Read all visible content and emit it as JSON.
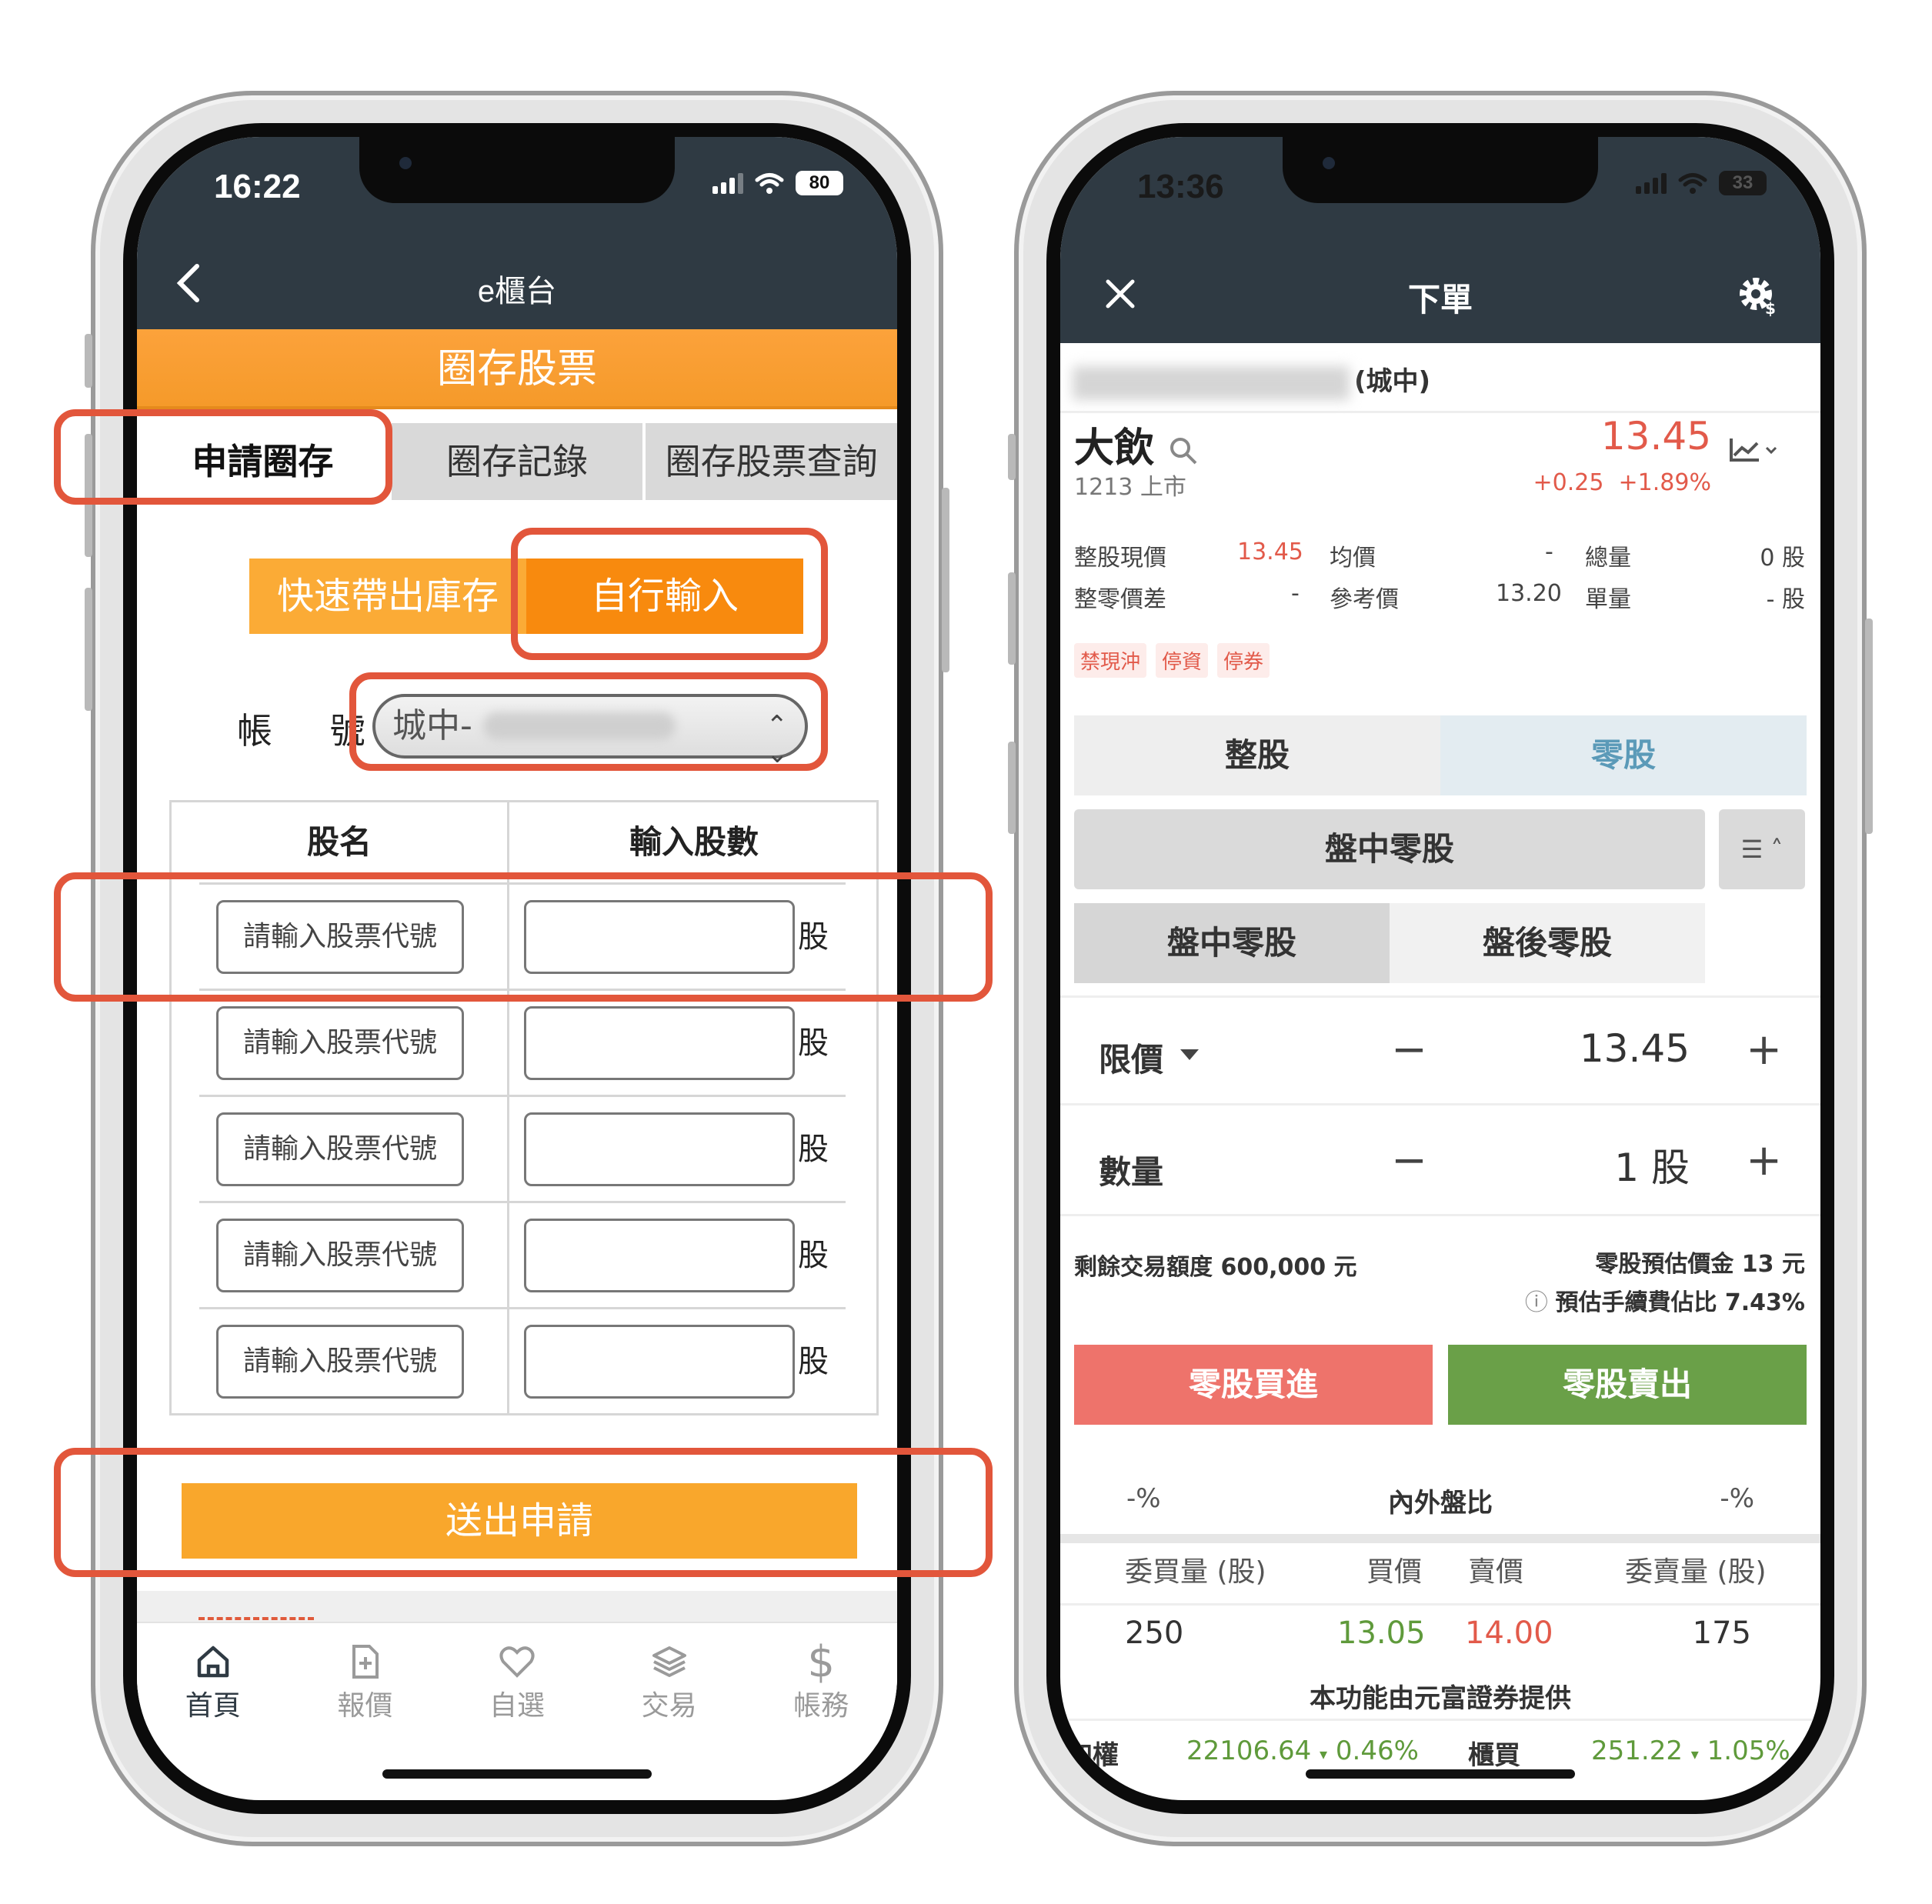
{
  "left_phone": {
    "status": {
      "time": "16:22",
      "battery": "80"
    },
    "header": {
      "title": "e櫃台"
    },
    "banner": {
      "title": "圈存股票"
    },
    "tabs": [
      {
        "label": "申請圈存",
        "active": true
      },
      {
        "label": "圈存記錄",
        "active": false
      },
      {
        "label": "圈存股票查詢",
        "active": false
      }
    ],
    "input_mode": {
      "quick": "快速帶出庫存",
      "manual": "自行輸入",
      "selected": "自行輸入"
    },
    "account": {
      "label": "帳 號",
      "value": "城中-"
    },
    "table": {
      "headers": [
        "股名",
        "輸入股數"
      ],
      "rows": [
        {
          "code_placeholder": "請輸入股票代號",
          "unit": "股"
        },
        {
          "code_placeholder": "請輸入股票代號",
          "unit": "股"
        },
        {
          "code_placeholder": "請輸入股票代號",
          "unit": "股"
        },
        {
          "code_placeholder": "請輸入股票代號",
          "unit": "股"
        },
        {
          "code_placeholder": "請輸入股票代號",
          "unit": "股"
        }
      ]
    },
    "submit": "送出申請",
    "tabbar": [
      {
        "label": "首頁",
        "icon": "home-icon",
        "active": true
      },
      {
        "label": "報價",
        "icon": "quote-doc-icon",
        "active": false
      },
      {
        "label": "自選",
        "icon": "heart-icon",
        "active": false
      },
      {
        "label": "交易",
        "icon": "layers-icon",
        "active": false
      },
      {
        "label": "帳務",
        "icon": "dollar-icon",
        "active": false
      }
    ],
    "colors": {
      "header": "#2f3a43",
      "orange": "#f9a72c",
      "orange_active": "#f88a0e",
      "highlight": "#e2563b"
    }
  },
  "right_phone": {
    "status": {
      "time": "13:36",
      "battery": "33"
    },
    "header": {
      "title": "下單"
    },
    "account_suffix": "(城中)",
    "stock": {
      "name": "大飲",
      "code": "1213 上市",
      "price": "13.45",
      "change": "+0.25",
      "change_pct": "+1.89%"
    },
    "stats": {
      "whole_price_label": "整股現價",
      "whole_price": "13.45",
      "avg_label": "均價",
      "avg": "-",
      "total_vol_label": "總量",
      "total_vol": "0 股",
      "odd_diff_label": "整零價差",
      "odd_diff": "-",
      "ref_label": "參考價",
      "ref": "13.20",
      "unit_vol_label": "單量",
      "unit_vol": "- 股"
    },
    "tags": [
      "禁現沖",
      "停資",
      "停券"
    ],
    "mode": {
      "whole": "整股",
      "odd": "零股",
      "selected": "零股"
    },
    "session": {
      "current": "盤中零股",
      "options": [
        "盤中零股",
        "盤後零股"
      ]
    },
    "price_row": {
      "label": "限價",
      "value": "13.45"
    },
    "qty_row": {
      "label": "數量",
      "value": "1 股"
    },
    "quota": "剩餘交易額度 600,000 元",
    "estimate": "零股預估價金 13 元",
    "fee": "預估手續費佔比 7.43%",
    "buy": "零股買進",
    "sell": "零股賣出",
    "ratio": {
      "left": "-%",
      "title": "內外盤比",
      "right": "-%"
    },
    "orderbook": {
      "headers": [
        "委買量 (股)",
        "買價",
        "賣價",
        "委賣量 (股)"
      ],
      "bid_qty": "250",
      "bid": "13.05",
      "ask": "14.00",
      "ask_qty": "175"
    },
    "provider": "本功能由元富證券提供",
    "indices": {
      "taiex_label": "加權",
      "taiex": "22106.64",
      "taiex_pct": "0.46%",
      "otc_label": "櫃買",
      "otc": "251.22",
      "otc_pct": "1.05%"
    },
    "colors": {
      "up": "#e25a4a",
      "down": "#5f9a3b",
      "buy": "#ee736b",
      "sell": "#6aa048"
    }
  }
}
